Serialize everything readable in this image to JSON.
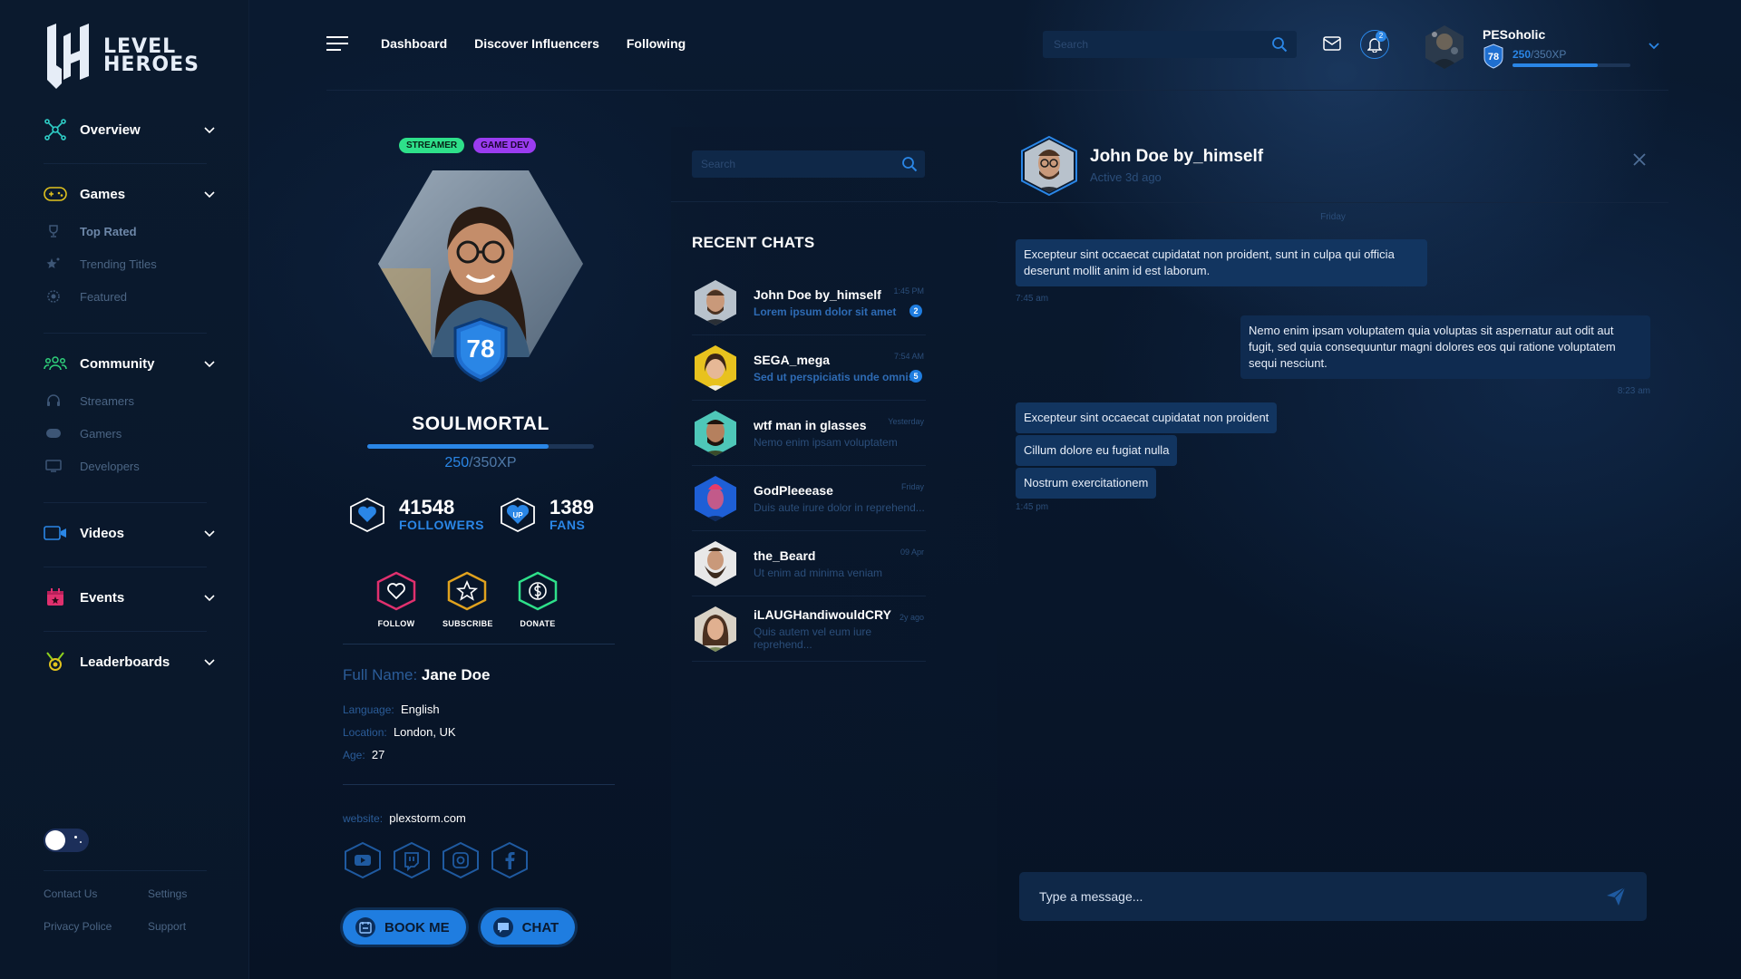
{
  "brand": {
    "line1": "LEVEL",
    "line2": "HEROES"
  },
  "sidebar": {
    "groups": [
      {
        "label": "Overview",
        "icon": "overview-network-icon"
      },
      {
        "label": "Games",
        "icon": "gamepad-icon",
        "items": [
          "Top Rated",
          "Trending Titles",
          "Featured"
        ]
      },
      {
        "label": "Community",
        "icon": "community-people-icon",
        "items": [
          "Streamers",
          "Gamers",
          "Developers"
        ]
      },
      {
        "label": "Videos",
        "icon": "video-camera-icon"
      },
      {
        "label": "Events",
        "icon": "calendar-icon"
      },
      {
        "label": "Leaderboards",
        "icon": "medal-icon"
      }
    ],
    "footer": {
      "contact": "Contact Us",
      "settings": "Settings",
      "privacy": "Privacy Police",
      "support": "Support"
    }
  },
  "topnav": {
    "dashboard": "Dashboard",
    "discover": "Discover Influencers",
    "following": "Following"
  },
  "top_search": {
    "placeholder": "Search"
  },
  "notifications": {
    "count": "2"
  },
  "user": {
    "name": "PESoholic",
    "level": "78",
    "xp": "250",
    "xp_total": "/350XP",
    "xp_progress": 0.72
  },
  "profile": {
    "tags": [
      "STREAMER",
      "GAME DEV"
    ],
    "level": "78",
    "name": "SOULMORTAL",
    "xp": "250",
    "xp_total": "/350XP",
    "xp_progress": 0.8,
    "followers_count": "41548",
    "followers_label": "FOLLOWERS",
    "fans_count": "1389",
    "fans_label": "FANS",
    "fans_icon_text": "UP",
    "actions": {
      "follow": "FOLLOW",
      "subscribe": "SUBSCRIBE",
      "donate": "DONATE"
    },
    "fullname_key": "Full Name:",
    "fullname": "Jane Doe",
    "language_key": "Language:",
    "language": "English",
    "location_key": "Location:",
    "location": "London, UK",
    "age_key": "Age:",
    "age": "27",
    "website_key": "website:",
    "website": "plexstorm.com",
    "book_label": "BOOK ME",
    "chat_label": "CHAT"
  },
  "chats": {
    "search_placeholder": "Search",
    "heading": "RECENT CHATS",
    "list": [
      {
        "name": "John Doe by_himself",
        "preview": "Lorem ipsum dolor sit amet",
        "time": "1:45 PM",
        "badge": "2"
      },
      {
        "name": "SEGA_mega",
        "preview": "Sed ut perspiciatis unde omnis",
        "time": "7:54 AM",
        "badge": "5"
      },
      {
        "name": "wtf man in glasses",
        "preview": "Nemo enim ipsam voluptatem",
        "time": "Yesterday"
      },
      {
        "name": "GodPleeease",
        "preview": "Duis aute irure dolor in reprehend...",
        "time": "Friday"
      },
      {
        "name": "the_Beard",
        "preview": "Ut enim ad minima veniam",
        "time": "09 Apr"
      },
      {
        "name": "iLAUGHandiwouldCRY",
        "preview": "Quis autem vel eum iure reprehend...",
        "time": "2y ago"
      }
    ]
  },
  "conversation": {
    "name": "John Doe by_himself",
    "status": "Active 3d ago",
    "day": "Friday",
    "messages": [
      {
        "text": "Excepteur sint occaecat cupidatat non proident, sunt in culpa qui officia deserunt mollit anim id est laborum.",
        "time": "7:45 am"
      },
      {
        "text": "Nemo enim ipsam voluptatem quia voluptas sit aspernatur aut odit aut fugit, sed quia consequuntur magni dolores eos qui ratione voluptatem sequi nesciunt.",
        "time": "8:23 am"
      },
      {
        "text": "Excepteur sint occaecat cupidatat non proident"
      },
      {
        "text": "Cillum dolore eu fugiat nulla"
      },
      {
        "text": "Nostrum exercitationem",
        "time": "1:45 pm"
      }
    ],
    "composer_placeholder": "Type a  message..."
  }
}
